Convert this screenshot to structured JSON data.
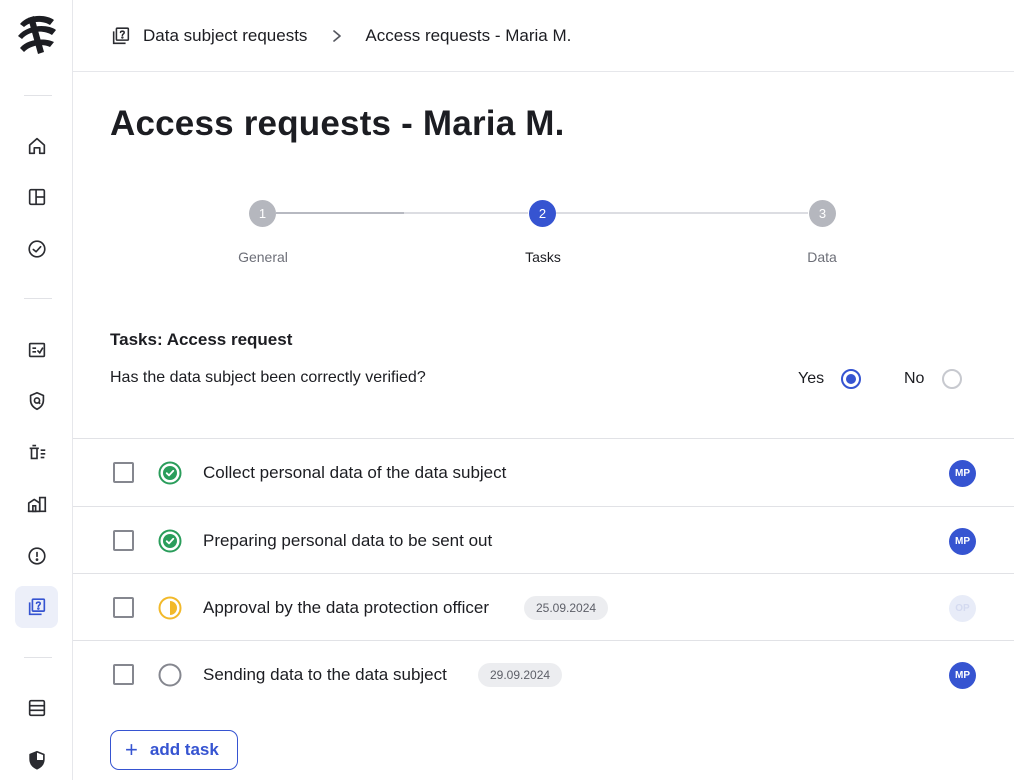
{
  "breadcrumb": {
    "root": "Data subject requests",
    "current": "Access requests - Maria M."
  },
  "page_title": "Access requests - Maria M.",
  "stepper": [
    {
      "number": "1",
      "label": "General",
      "state": "done"
    },
    {
      "number": "2",
      "label": "Tasks",
      "state": "active"
    },
    {
      "number": "3",
      "label": "Data",
      "state": "pending"
    }
  ],
  "tasks_section": {
    "title": "Tasks: Access request",
    "question": "Has the data subject been correctly verified?",
    "yes_label": "Yes",
    "no_label": "No",
    "selected": "Yes"
  },
  "tasks": [
    {
      "label": "Collect personal data of the data subject",
      "status": "done",
      "date": "",
      "assignee": "MP"
    },
    {
      "label": "Preparing personal data to be sent out",
      "status": "done",
      "date": "",
      "assignee": "MP"
    },
    {
      "label": "Approval by the data protection officer",
      "status": "in-progress",
      "date": "25.09.2024",
      "assignee": "OP"
    },
    {
      "label": "Sending data to the data subject",
      "status": "open",
      "date": "29.09.2024",
      "assignee": "MP"
    }
  ],
  "add_task_label": "add task",
  "sidebar": {
    "items": [
      {
        "icon": "home-icon"
      },
      {
        "icon": "layout-icon"
      },
      {
        "icon": "check-circle-icon"
      },
      {
        "icon": "checklist-icon"
      },
      {
        "icon": "shield-search-icon"
      },
      {
        "icon": "delete-list-icon"
      },
      {
        "icon": "buildings-icon"
      },
      {
        "icon": "alert-circle-icon"
      },
      {
        "icon": "question-doc-icon",
        "active": true
      },
      {
        "icon": "database-icon"
      },
      {
        "icon": "shield-half-icon"
      }
    ]
  },
  "colors": {
    "accent": "#3654d1",
    "success": "#2a9d5b",
    "warning": "#f2b92a"
  }
}
